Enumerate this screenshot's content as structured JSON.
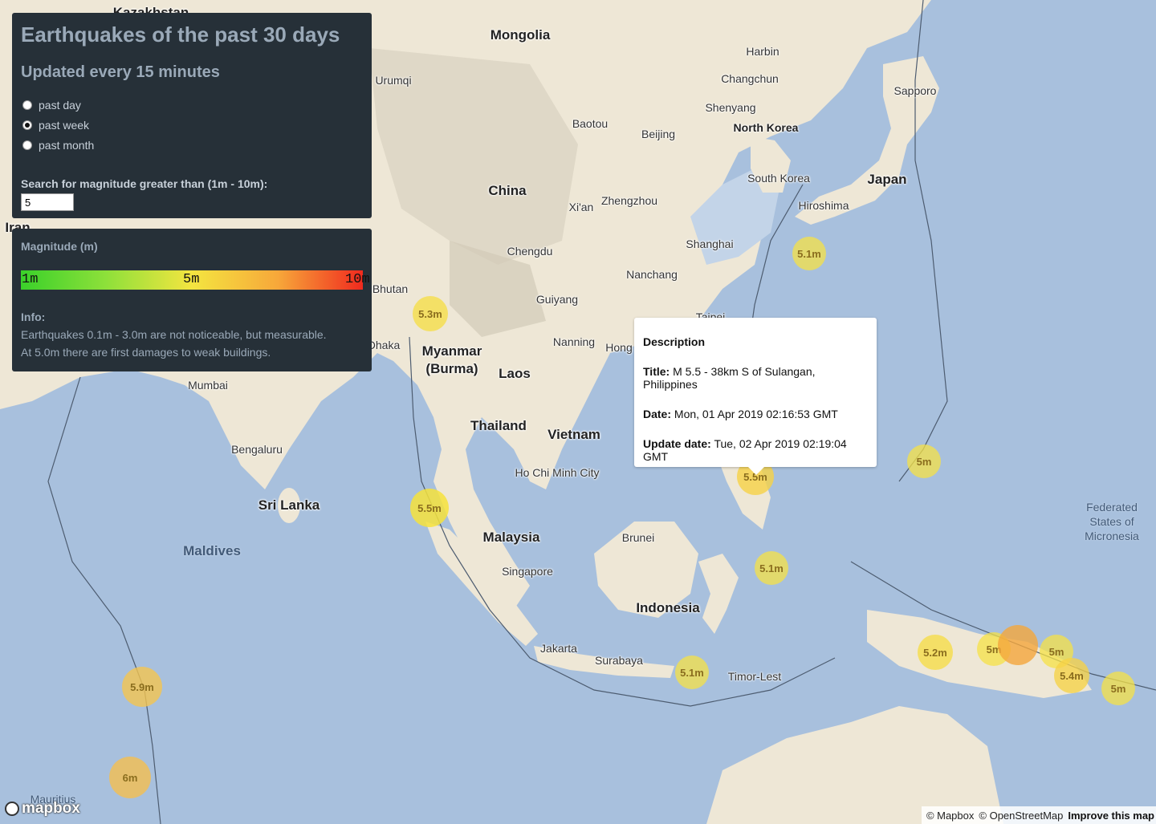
{
  "controls": {
    "title": "Earthquakes of the past 30 days",
    "subtitle": "Updated every 15 minutes",
    "radios": [
      {
        "label": "past day",
        "checked": false
      },
      {
        "label": "past week",
        "checked": true
      },
      {
        "label": "past month",
        "checked": false
      }
    ],
    "search_label": "Search for magnitude greater than (1m - 10m):",
    "search_value": "5"
  },
  "legend": {
    "title": "Magnitude (m)",
    "scale_labels": [
      "1m",
      "5m",
      "10m"
    ],
    "scale_colors": [
      "#3ad12a",
      "#f4e540",
      "#f02a1e"
    ],
    "info_title": "Info:",
    "info_lines": [
      "Earthquakes 0.1m - 3.0m are not noticeable, but measurable.",
      "At 5.0m there are first damages to weak buildings."
    ]
  },
  "popup": {
    "heading": "Description",
    "title_label": "Title:",
    "title_value": "M 5.5 - 38km S of Sulangan, Philippines",
    "date_label": "Date:",
    "date_value": "Mon, 01 Apr 2019 02:16:53 GMT",
    "update_label": "Update date:",
    "update_value": "Tue, 02 Apr 2019 02:19:04 GMT"
  },
  "places": [
    {
      "name": "Kazakhstan",
      "kind": "country"
    },
    {
      "name": "Mongolia",
      "kind": "country"
    },
    {
      "name": "Harbin",
      "kind": "city"
    },
    {
      "name": "Changchun",
      "kind": "city"
    },
    {
      "name": "Sapporo",
      "kind": "city"
    },
    {
      "name": "Shenyang",
      "kind": "city"
    },
    {
      "name": "North Korea",
      "kind": "city"
    },
    {
      "name": "Baotou",
      "kind": "city"
    },
    {
      "name": "Beijing",
      "kind": "city"
    },
    {
      "name": "Urumqi",
      "kind": "city"
    },
    {
      "name": "South Korea",
      "kind": "city"
    },
    {
      "name": "Japan",
      "kind": "country"
    },
    {
      "name": "China",
      "kind": "country"
    },
    {
      "name": "Xi'an",
      "kind": "city"
    },
    {
      "name": "Zhengzhou",
      "kind": "city"
    },
    {
      "name": "Hiroshima",
      "kind": "city"
    },
    {
      "name": "Shanghai",
      "kind": "city"
    },
    {
      "name": "Chengdu",
      "kind": "city"
    },
    {
      "name": "Nanchang",
      "kind": "city"
    },
    {
      "name": "Guiyang",
      "kind": "city"
    },
    {
      "name": "Taipei",
      "kind": "city"
    },
    {
      "name": "Bhutan",
      "kind": "city"
    },
    {
      "name": "Nanning",
      "kind": "city"
    },
    {
      "name": "Hong",
      "kind": "city"
    },
    {
      "name": "Myanmar",
      "kind": "country"
    },
    {
      "name": "(Burma)",
      "kind": "country"
    },
    {
      "name": "Laos",
      "kind": "country"
    },
    {
      "name": "Dhaka",
      "kind": "city"
    },
    {
      "name": "Mumbai",
      "kind": "city"
    },
    {
      "name": "Thailand",
      "kind": "country"
    },
    {
      "name": "Vietnam",
      "kind": "country"
    },
    {
      "name": "Bengaluru",
      "kind": "city"
    },
    {
      "name": "Ho Chi Minh City",
      "kind": "city"
    },
    {
      "name": "Sri Lanka",
      "kind": "country"
    },
    {
      "name": "Federated",
      "kind": "sea"
    },
    {
      "name": "States of",
      "kind": "sea"
    },
    {
      "name": "Micronesia",
      "kind": "sea"
    },
    {
      "name": "Malaysia",
      "kind": "country"
    },
    {
      "name": "Brunei",
      "kind": "city"
    },
    {
      "name": "Maldives",
      "kind": "sea"
    },
    {
      "name": "Singapore",
      "kind": "city"
    },
    {
      "name": "Indonesia",
      "kind": "country"
    },
    {
      "name": "Jakarta",
      "kind": "city"
    },
    {
      "name": "Surabaya",
      "kind": "city"
    },
    {
      "name": "Timor-Lest",
      "kind": "city"
    },
    {
      "name": "Iran",
      "kind": "country"
    },
    {
      "name": "Mauritius",
      "kind": "sea"
    }
  ],
  "quakes": [
    {
      "label": "5.1m",
      "magnitude": 5.1
    },
    {
      "label": "5.3m",
      "magnitude": 5.3
    },
    {
      "label": "5m",
      "magnitude": 5.0
    },
    {
      "label": "5.5m",
      "magnitude": 5.5
    },
    {
      "label": "5.5m",
      "magnitude": 5.5,
      "selected": true
    },
    {
      "label": "5.1m",
      "magnitude": 5.1
    },
    {
      "label": "5.2m",
      "magnitude": 5.2
    },
    {
      "label": "5m",
      "magnitude": 5.0
    },
    {
      "label": "",
      "magnitude": 6.5
    },
    {
      "label": "5m",
      "magnitude": 5.0
    },
    {
      "label": "5.4m",
      "magnitude": 5.4
    },
    {
      "label": "5m",
      "magnitude": 5.0
    },
    {
      "label": "5.1m",
      "magnitude": 5.1
    },
    {
      "label": "5.9m",
      "magnitude": 5.9
    },
    {
      "label": "6m",
      "magnitude": 6.0
    }
  ],
  "attribution": {
    "mapbox": "© Mapbox",
    "osm": "© OpenStreetMap",
    "improve": "Improve this map",
    "logo": "mapbox"
  }
}
